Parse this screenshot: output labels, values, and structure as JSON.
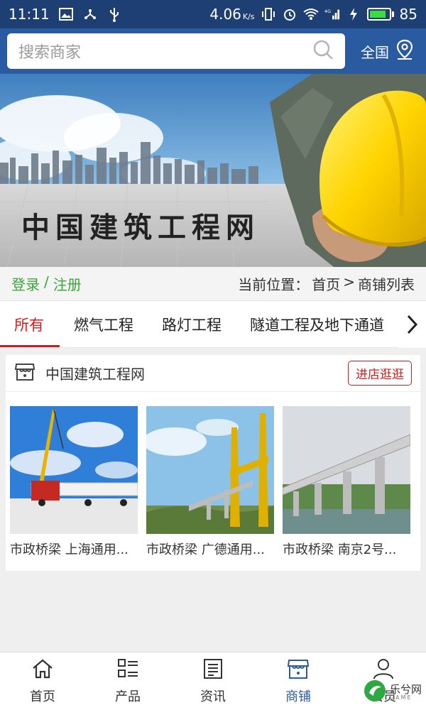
{
  "status_bar": {
    "time": "11:11",
    "speed": "4.06",
    "speed_unit": "K/s",
    "network": "4G",
    "battery": "85",
    "battery_level": 0.85
  },
  "header": {
    "search_placeholder": "搜索商家",
    "region_label": "全国"
  },
  "banner": {
    "title": "中国建筑工程网"
  },
  "login_row": {
    "login": "登录",
    "separator": "/",
    "register": "注册",
    "location_label": "当前位置：",
    "location_home": "首页",
    "location_arrow": ">",
    "location_current": "商铺列表"
  },
  "tabs": [
    {
      "label": "所有",
      "active": true
    },
    {
      "label": "燃气工程",
      "active": false
    },
    {
      "label": "路灯工程",
      "active": false
    },
    {
      "label": "隧道工程及地下通道",
      "active": false
    }
  ],
  "shop": {
    "name": "中国建筑工程网",
    "visit_label": "进店逛逛",
    "products": [
      {
        "title": "市政桥梁 上海通用..."
      },
      {
        "title": "市政桥梁 广德通用..."
      },
      {
        "title": "市政桥梁 南京2号..."
      }
    ]
  },
  "bottom_nav": [
    {
      "label": "首页",
      "icon": "home-icon",
      "active": false
    },
    {
      "label": "产品",
      "icon": "list-icon",
      "active": false
    },
    {
      "label": "资讯",
      "icon": "news-icon",
      "active": false
    },
    {
      "label": "商铺",
      "icon": "store-icon",
      "active": true
    },
    {
      "label": "会员",
      "icon": "user-icon",
      "active": false
    }
  ],
  "watermark": {
    "text": "乐兮网",
    "sub": "GAME"
  },
  "colors": {
    "status_bar_bg": "#1e3f74",
    "header_bg": "#2a5aa0",
    "accent_red": "#c8201f",
    "login_green": "#3aa63a",
    "nav_active": "#2a5aa0"
  }
}
